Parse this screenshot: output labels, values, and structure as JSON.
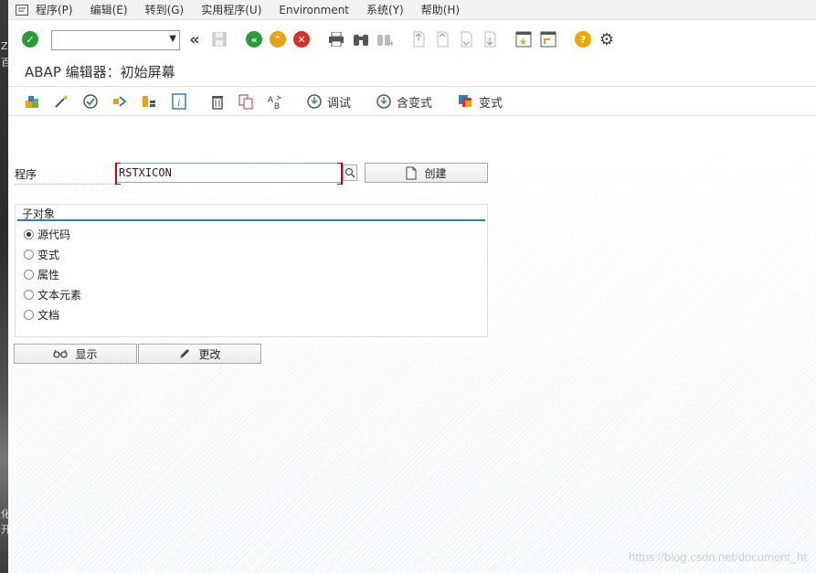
{
  "menubar": {
    "items": [
      "程序(P)",
      "编辑(E)",
      "转到(G)",
      "实用程序(U)",
      "Environment",
      "系统(Y)",
      "帮助(H)"
    ]
  },
  "toolbar": {
    "command_field_value": "",
    "icons": [
      "enter-check-icon",
      "back-arrows-icon",
      "save-icon",
      "back-icon",
      "exit-icon",
      "cancel-icon",
      "print-icon",
      "find-icon",
      "find-next-icon",
      "first-page-icon",
      "previous-page-icon",
      "next-page-icon",
      "last-page-icon",
      "create-session-icon",
      "shortcut-icon",
      "help-icon",
      "settings-gear-icon"
    ]
  },
  "screen": {
    "title": "ABAP 编辑器：初始屏幕"
  },
  "app_toolbar": {
    "debug_label": "调试",
    "debug_variant_label": "含变式",
    "variants_label": "变式"
  },
  "program": {
    "label": "程序",
    "value": "RSTXICON",
    "create_label": "创建"
  },
  "subobjects": {
    "title": "子对象",
    "options": [
      {
        "label": "源代码",
        "selected": true
      },
      {
        "label": "变式",
        "selected": false
      },
      {
        "label": "属性",
        "selected": false
      },
      {
        "label": "文本元素",
        "selected": false
      },
      {
        "label": "文档",
        "selected": false
      }
    ]
  },
  "actions": {
    "display_label": "显示",
    "change_label": "更改"
  },
  "left_strip": {
    "chars": [
      "Z",
      "百",
      "化",
      "开"
    ]
  },
  "watermark": "https://blog.csdn.net/document_ht",
  "colors": {
    "enter_green": "#2a9d3a",
    "back_green": "#2a9d3a",
    "exit_orange": "#e8a21a",
    "cancel_red": "#d93025",
    "help_orange": "#f0a500",
    "accent_blue": "#2e7fb3"
  }
}
